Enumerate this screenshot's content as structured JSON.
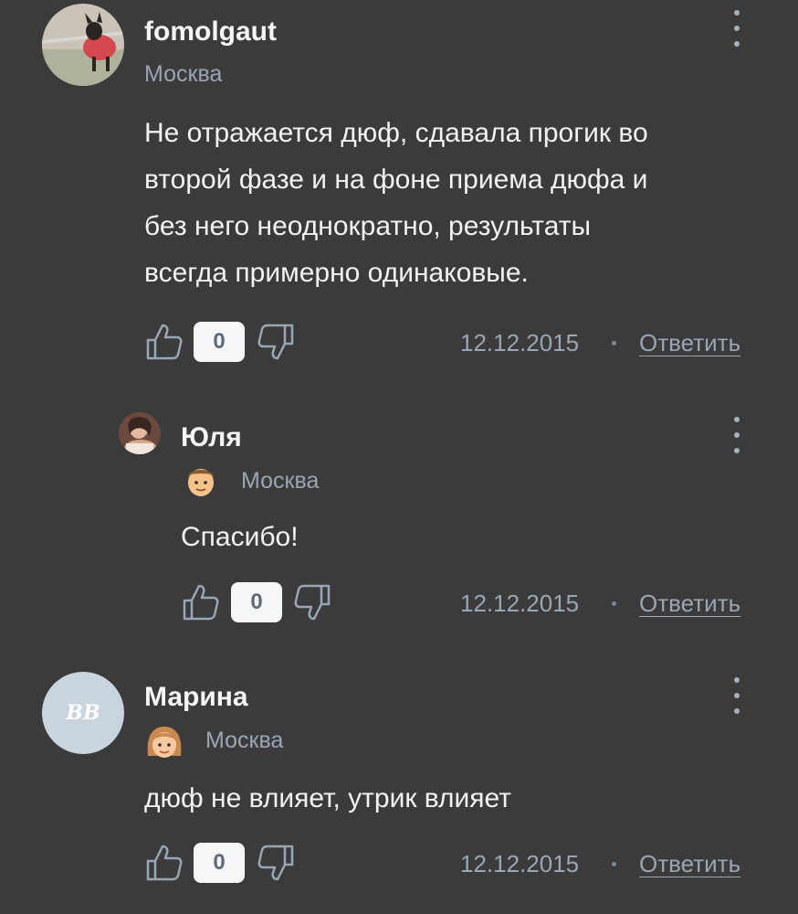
{
  "comments": [
    {
      "username": "fomolgaut",
      "city": "Москва",
      "text_lines": [
        "Не отражается дюф, сдавала прогик во",
        "второй фазе и на фоне приема дюфа и",
        "без него неоднократно, результаты",
        "всегда примерно одинаковые."
      ],
      "likes": "0",
      "date": "12.12.2015",
      "reply_label": "Ответить",
      "avatar": "dog-photo"
    },
    {
      "username": "Юля",
      "city": "Москва",
      "badge": "boy-face-emoji",
      "text_lines": [
        "Спасибо!"
      ],
      "likes": "0",
      "date": "12.12.2015",
      "reply_label": "Ответить",
      "avatar": "woman-photo"
    },
    {
      "username": "Марина",
      "city": "Москва",
      "badge": "girl-face-emoji",
      "avatar_initials": "ВВ",
      "text_lines": [
        "дюф не влияет, утрик влияет"
      ],
      "likes": "0",
      "date": "12.12.2015",
      "reply_label": "Ответить",
      "avatar": "initials"
    }
  ],
  "colors": {
    "background": "#3b3b3b",
    "muted_text": "#9aa6b2",
    "count_bg": "#f4f6f8",
    "avatar_initials_bg": "#c9d4dd"
  },
  "icons": [
    "thumbs-up-icon",
    "thumbs-down-icon",
    "more-vertical-icon"
  ]
}
